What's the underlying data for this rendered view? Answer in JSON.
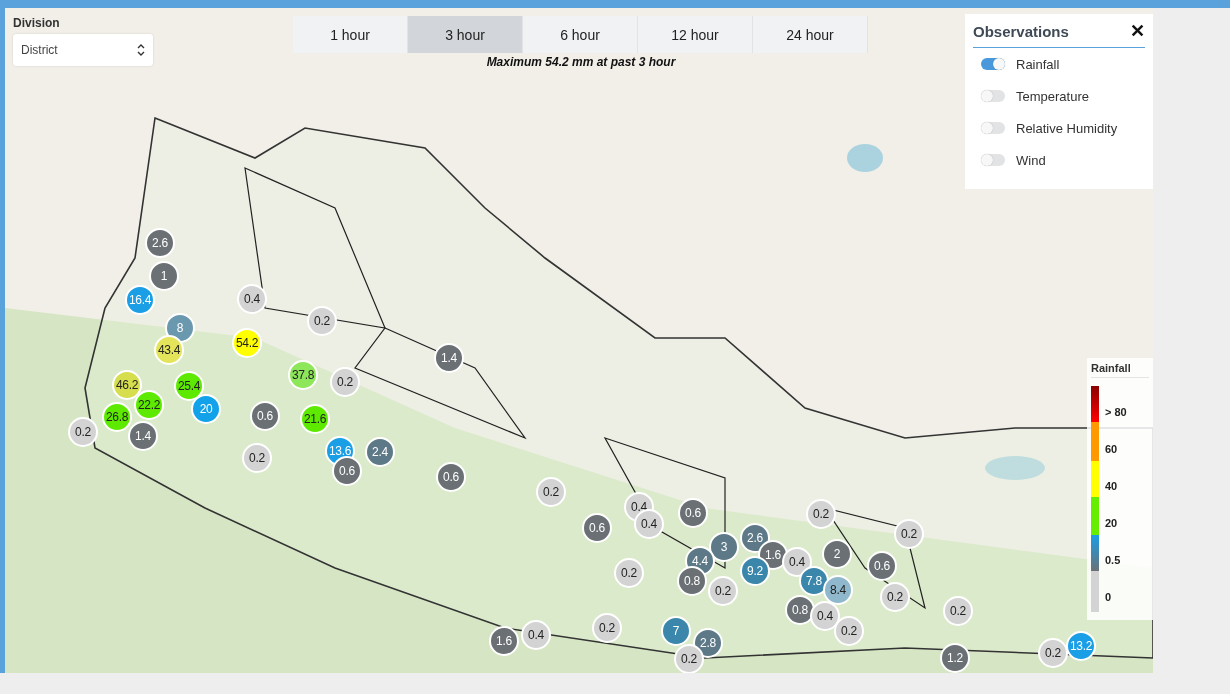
{
  "division": {
    "label": "Division",
    "value": "District"
  },
  "tabs": [
    {
      "label": "1 hour",
      "selected": false
    },
    {
      "label": "3 hour",
      "selected": true
    },
    {
      "label": "6 hour",
      "selected": false
    },
    {
      "label": "12 hour",
      "selected": false
    },
    {
      "label": "24 hour",
      "selected": false
    }
  ],
  "summary": "Maximum 54.2 mm at past 3 hour",
  "observations": {
    "title": "Observations",
    "close": "✕",
    "items": [
      {
        "label": "Rainfall",
        "on": true
      },
      {
        "label": "Temperature",
        "on": false
      },
      {
        "label": "Relative Humidity",
        "on": false
      },
      {
        "label": "Wind",
        "on": false
      }
    ]
  },
  "legend": {
    "title": "Rainfall",
    "labels": [
      "> 80",
      "60",
      "40",
      "20",
      "0.5",
      "0"
    ]
  },
  "markers": [
    {
      "value": "2.6",
      "color": "#6b7075"
    },
    {
      "value": "1",
      "color": "#6b7075"
    },
    {
      "value": "16.4",
      "color": "#1a9ee6"
    },
    {
      "value": "0.4",
      "color": "#d3d3d3"
    },
    {
      "value": "0.2",
      "color": "#d3d3d3"
    },
    {
      "value": "8",
      "color": "#6a98ae"
    },
    {
      "value": "54.2",
      "color": "#ffff00"
    },
    {
      "value": "43.4",
      "color": "#e4e45a"
    },
    {
      "value": "1.4",
      "color": "#6b7075"
    },
    {
      "value": "25.4",
      "color": "#5eea00"
    },
    {
      "value": "0.2",
      "color": "#d3d3d3"
    },
    {
      "value": "37.8",
      "color": "#8ee65a"
    },
    {
      "value": "46.2",
      "color": "#d6de4e"
    },
    {
      "value": "22.2",
      "color": "#5eea00"
    },
    {
      "value": "20",
      "color": "#12a2ea"
    },
    {
      "value": "26.8",
      "color": "#5eea00"
    },
    {
      "value": "0.6",
      "color": "#6b7075"
    },
    {
      "value": "21.6",
      "color": "#5eea00"
    },
    {
      "value": "0.2",
      "color": "#d3d3d3"
    },
    {
      "value": "1.4",
      "color": "#6b7075"
    },
    {
      "value": "13.6",
      "color": "#1a9ee6"
    },
    {
      "value": "2.4",
      "color": "#5d7887"
    },
    {
      "value": "0.2",
      "color": "#d3d3d3"
    },
    {
      "value": "0.6",
      "color": "#6b7075"
    },
    {
      "value": "0.6",
      "color": "#6b7075"
    },
    {
      "value": "0.2",
      "color": "#d3d3d3"
    },
    {
      "value": "0.4",
      "color": "#d3d3d3"
    },
    {
      "value": "0.4",
      "color": "#d3d3d3"
    },
    {
      "value": "0.6",
      "color": "#6b7075"
    },
    {
      "value": "0.6",
      "color": "#6b7075"
    },
    {
      "value": "0.2",
      "color": "#d3d3d3"
    },
    {
      "value": "0.2",
      "color": "#d3d3d3"
    },
    {
      "value": "3",
      "color": "#5d7887"
    },
    {
      "value": "2.6",
      "color": "#5d7887"
    },
    {
      "value": "2",
      "color": "#6b7075"
    },
    {
      "value": "4.4",
      "color": "#5d7887"
    },
    {
      "value": "1.6",
      "color": "#6b7075"
    },
    {
      "value": "0.4",
      "color": "#d3d3d3"
    },
    {
      "value": "9.2",
      "color": "#3a87ab"
    },
    {
      "value": "0.6",
      "color": "#6b7075"
    },
    {
      "value": "0.2",
      "color": "#d3d3d3"
    },
    {
      "value": "0.8",
      "color": "#6b7075"
    },
    {
      "value": "0.2",
      "color": "#d3d3d3"
    },
    {
      "value": "7.8",
      "color": "#3a87ab"
    },
    {
      "value": "8.4",
      "color": "#8fb8cc"
    },
    {
      "value": "0.8",
      "color": "#6b7075"
    },
    {
      "value": "0.4",
      "color": "#d3d3d3"
    },
    {
      "value": "0.2",
      "color": "#d3d3d3"
    },
    {
      "value": "0.2",
      "color": "#d3d3d3"
    },
    {
      "value": "0.2",
      "color": "#d3d3d3"
    },
    {
      "value": "7",
      "color": "#3a87ab"
    },
    {
      "value": "2.8",
      "color": "#5d7887"
    },
    {
      "value": "0.4",
      "color": "#d3d3d3"
    },
    {
      "value": "1.6",
      "color": "#6b7075"
    },
    {
      "value": "0.2",
      "color": "#d3d3d3"
    },
    {
      "value": "0.2",
      "color": "#d3d3d3"
    },
    {
      "value": "1.2",
      "color": "#6b7075"
    },
    {
      "value": "0.2",
      "color": "#d3d3d3"
    },
    {
      "value": "13.2",
      "color": "#1a9ee6"
    }
  ]
}
